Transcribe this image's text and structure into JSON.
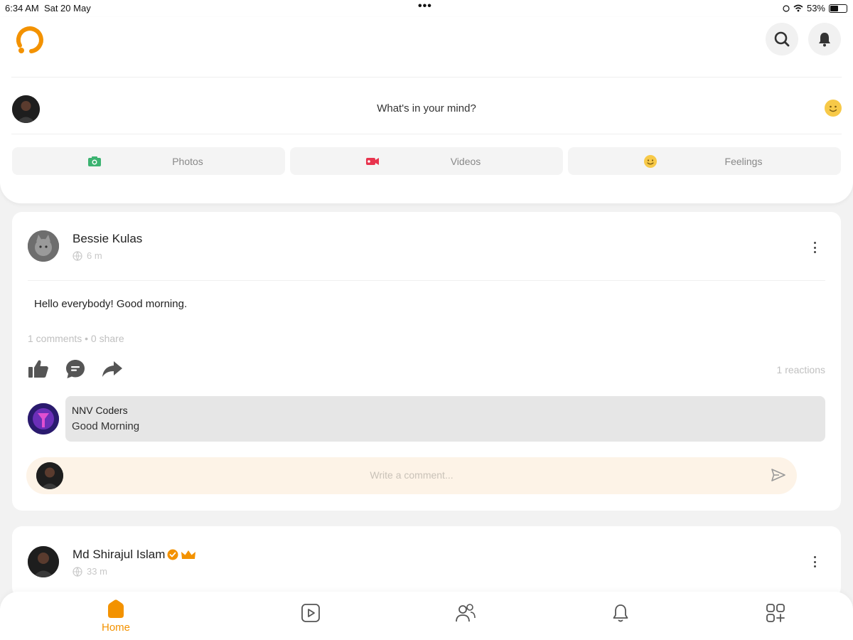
{
  "status_bar": {
    "time": "6:34 AM",
    "date": "Sat 20 May",
    "battery": "53%",
    "battery_level": 0.53
  },
  "header": {
    "logo_icon": "app-logo-icon",
    "search_icon": "search-icon",
    "notifications_icon": "bell-icon"
  },
  "composer": {
    "placeholder": "What's in your mind?",
    "emoji_icon": "smiley-icon",
    "actions": [
      {
        "label": "Photos",
        "icon": "camera-icon",
        "color": "#3cb371"
      },
      {
        "label": "Videos",
        "icon": "video-icon",
        "color": "#e8344e"
      },
      {
        "label": "Feelings",
        "icon": "smiley-icon",
        "color": "#f7c948"
      }
    ]
  },
  "posts": [
    {
      "author": "Bessie Kulas",
      "time": "6 m",
      "text": "Hello everybody! Good morning.",
      "stats": "1 comments • 0 share",
      "reactions": "1 reactions",
      "comment": {
        "author": "NNV Coders",
        "text": "Good Morning"
      },
      "write_comment_placeholder": "Write a comment..."
    },
    {
      "author": "Md Shirajul Islam",
      "time": "33 m",
      "verified_icon": "verified-badge-icon",
      "crown_icon": "crown-icon"
    }
  ],
  "bottom_nav": {
    "items": [
      {
        "label": "Home",
        "icon": "home-icon",
        "active": true
      },
      {
        "label": "",
        "icon": "video-play-icon",
        "active": false
      },
      {
        "label": "",
        "icon": "friends-icon",
        "active": false
      },
      {
        "label": "",
        "icon": "bell-icon",
        "active": false
      },
      {
        "label": "",
        "icon": "apps-add-icon",
        "active": false
      }
    ]
  },
  "colors": {
    "accent": "#f39200",
    "comment_input_bg": "#fdf3e7"
  }
}
